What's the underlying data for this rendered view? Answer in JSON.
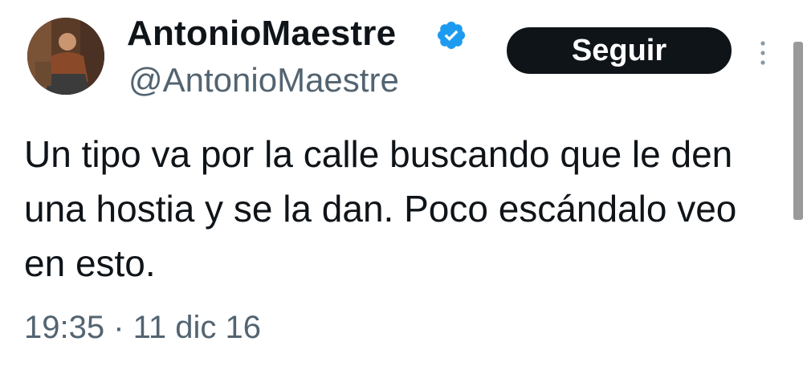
{
  "author": {
    "display_name": "AntonioMaestre",
    "handle": "@AntonioMaestre",
    "verified": true
  },
  "actions": {
    "follow_label": "Seguir"
  },
  "tweet": {
    "text": "Un tipo va por la calle buscando que le den una hostia y se la dan. Poco escándalo veo en esto.",
    "timestamp": "19:35 · 11 dic 16"
  },
  "icons": {
    "verified": "verified-badge-icon",
    "more": "more-vertical-icon"
  },
  "colors": {
    "text_primary": "#0f1419",
    "text_secondary": "#536471",
    "verified_blue": "#1d9bf0",
    "button_bg": "#0f1419",
    "button_text": "#ffffff"
  }
}
